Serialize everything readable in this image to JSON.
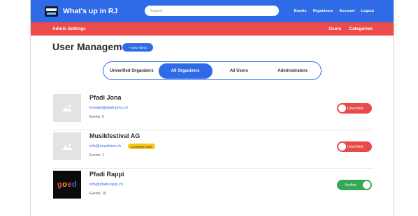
{
  "header": {
    "brand": "What's up in RJ",
    "search_placeholder": "Search",
    "nav": [
      "Events",
      "Organizers",
      "Account",
      "Logout"
    ]
  },
  "subheader": {
    "title": "Admin Settings",
    "nav": [
      "Users",
      "Categories"
    ]
  },
  "main": {
    "title": "User Management",
    "new_admin_label": "+ New Admin",
    "tabs": [
      "Unverified Organizers",
      "All Organizers",
      "All Users",
      "Administrators"
    ],
    "active_tab": "All Organizers"
  },
  "organizers": [
    {
      "name": "Pfadi Jona",
      "email": "kontakt@pfadi-jona.ch",
      "badge": "",
      "events": "Events: 0",
      "status": "Unverified",
      "verified": false,
      "avatar": "placeholder-image-icon"
    },
    {
      "name": "Musikfestival AG",
      "email": "info@musikfest.ch",
      "badge": "Unverified Email",
      "events": "Events: 1",
      "status": "Unverified",
      "verified": false,
      "avatar": "placeholder-image-icon"
    },
    {
      "name": "Pfadi Rappi",
      "email": "info@pfadi-rappi.ch",
      "badge": "",
      "events": "Events: 10",
      "status": "Verified",
      "verified": true,
      "avatar": "goed-logo",
      "logo_text": "goed"
    }
  ],
  "colors": {
    "primary": "#2f6be6",
    "secondary": "#eb4b4b",
    "verified": "#34a853",
    "unverified": "#e84a4a",
    "badge": "#f5c518"
  }
}
